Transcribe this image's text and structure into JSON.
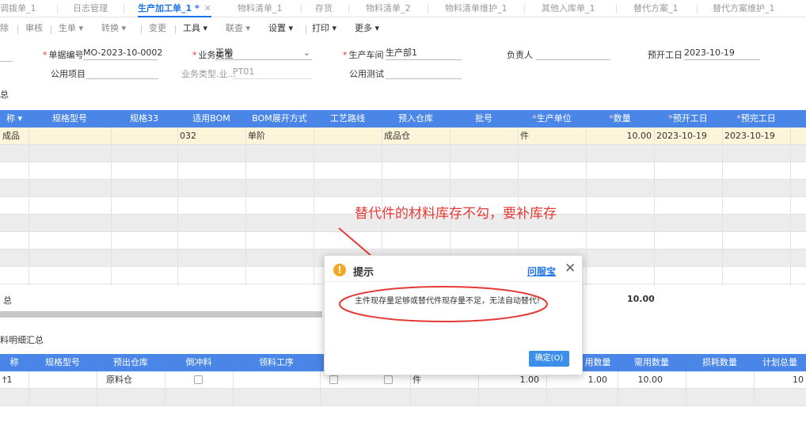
{
  "tabs": [
    {
      "label": "调拨单_1"
    },
    {
      "label": "日志管理"
    },
    {
      "label": "生产加工单_1 *",
      "active": true
    },
    {
      "label": "物料清单_1"
    },
    {
      "label": "存货"
    },
    {
      "label": "物料清单_2"
    },
    {
      "label": "物料清单维护_1"
    },
    {
      "label": "其他入库单_1"
    },
    {
      "label": "替代方案_1"
    },
    {
      "label": "替代方案维护_1"
    }
  ],
  "toolbar": {
    "items": [
      "除",
      "审核",
      "生单 ▾",
      "转换 ▾",
      "变更",
      "工具 ▾",
      "联查 ▾",
      "设置 ▾",
      "打印 ▾",
      "更多 ▾"
    ]
  },
  "form": {
    "bill_no_label": "单据编号",
    "bill_no_value": "MO-2023-10-0002",
    "biz_type_label": "业务类型",
    "biz_type_value": "正常",
    "workshop_label": "生产车间",
    "workshop_value": "生产部1",
    "owner_label": "负责人",
    "owner_value": "",
    "start_date_label": "预开工日",
    "start_date_value": "2023-10-19",
    "public_item_label": "公用项目",
    "public_item_value": "",
    "biz_type_ext_label": "业务类型.业...",
    "biz_type_ext_value": "PT01",
    "public_test_label": "公用测试",
    "public_test_value": "",
    "section_label": "总"
  },
  "table": {
    "headers": [
      {
        "label": "称"
      },
      {
        "label": "规格型号"
      },
      {
        "label": "规格33"
      },
      {
        "label": "适用BOM"
      },
      {
        "label": "BOM展开方式"
      },
      {
        "label": "工艺路线"
      },
      {
        "label": "预入仓库"
      },
      {
        "label": "批号"
      },
      {
        "label": "生产单位",
        "req": true
      },
      {
        "label": "数量",
        "req": true
      },
      {
        "label": "预开工日",
        "req": true
      },
      {
        "label": "预完工日",
        "req": true
      }
    ],
    "row": {
      "name": "成品",
      "spec": "",
      "spec33": "",
      "bom": "032",
      "bom_mode": "单阶",
      "route": "",
      "warehouse": "成品仓",
      "batch": "",
      "unit": "件",
      "qty": "10.00",
      "start": "2023-10-19",
      "end": "2023-10-19"
    },
    "total_qty": "10.00"
  },
  "sub": {
    "title": "料明细汇总",
    "headers": [
      {
        "label": "称"
      },
      {
        "label": "规格型号"
      },
      {
        "label": "预出仓库"
      },
      {
        "label": "倒冲料"
      },
      {
        "label": "领料工序"
      },
      {
        "label": "用数量"
      },
      {
        "label": "需用数量"
      },
      {
        "label": "损耗数量"
      },
      {
        "label": "计划总量"
      }
    ],
    "row": {
      "name": "†1",
      "spec": "",
      "warehouse": "原料仓",
      "unit": "件",
      "base_qty": "1.00",
      "use_qty": "1.00",
      "need_qty": "10.00",
      "plan_total": "10"
    }
  },
  "dialog": {
    "title": "提示",
    "help_link": "问服宝",
    "message": "主件现存量足够或替代件现存量不足，无法自动替代!",
    "ok_label": "确定(O)"
  },
  "annotation": "替代件的材料库存不勾，要补库存",
  "colors": {
    "header_blue": "#4a86e8",
    "accent_blue": "#1a73e8",
    "warning_orange": "#f5a623",
    "annotation_red": "#e53935",
    "selected_row": "#fdf5d9"
  }
}
